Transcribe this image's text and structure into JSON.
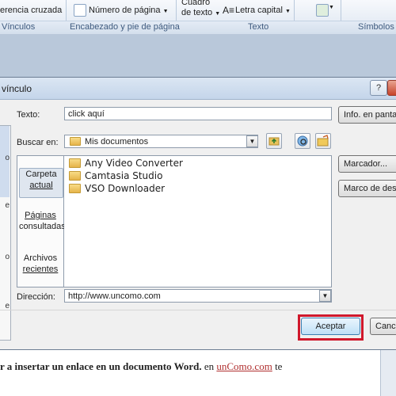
{
  "ribbon": {
    "cross_ref": "erencia cruzada",
    "page_number": "Número de página",
    "text_box_line1": "Cuadro",
    "text_box_line2": "de texto",
    "drop_cap": "Letra capital",
    "group_links": "Vínculos",
    "group_header_footer": "Encabezado y pie de página",
    "group_text": "Texto",
    "group_symbols": "Símbolos"
  },
  "dialog": {
    "title": "vínculo",
    "help_label": "?",
    "text_label": "Texto:",
    "text_value": "click aquí",
    "screen_tip_button": "Info. en pantalla",
    "search_in_label": "Buscar en:",
    "search_in_value": "Mis documentos",
    "left_strip_labels": [
      "o",
      "e",
      "o",
      "e"
    ],
    "places": [
      {
        "line1": "Carpeta",
        "line2": "actual"
      },
      {
        "line1": "Páginas",
        "line2": "consultadas"
      },
      {
        "line1": "Archivos",
        "line2": "recientes"
      }
    ],
    "files": [
      "Any Video Converter",
      "Camtasia Studio",
      "VSO Downloader"
    ],
    "bookmark_button": "Marcador...",
    "target_frame_button": "Marco de destino...",
    "address_label": "Dirección:",
    "address_value": "http://www.uncomo.com",
    "ok_button": "Aceptar",
    "cancel_button": "Cancelar"
  },
  "document": {
    "line_prefix": "r a insertar un enlace en un documento Word.",
    "line_mid": " en ",
    "line_link": "unComo.com",
    "line_suffix": " te"
  },
  "colors": {
    "highlight_border": "#d0182c",
    "ribbon_group_text": "#3e5a7e"
  }
}
